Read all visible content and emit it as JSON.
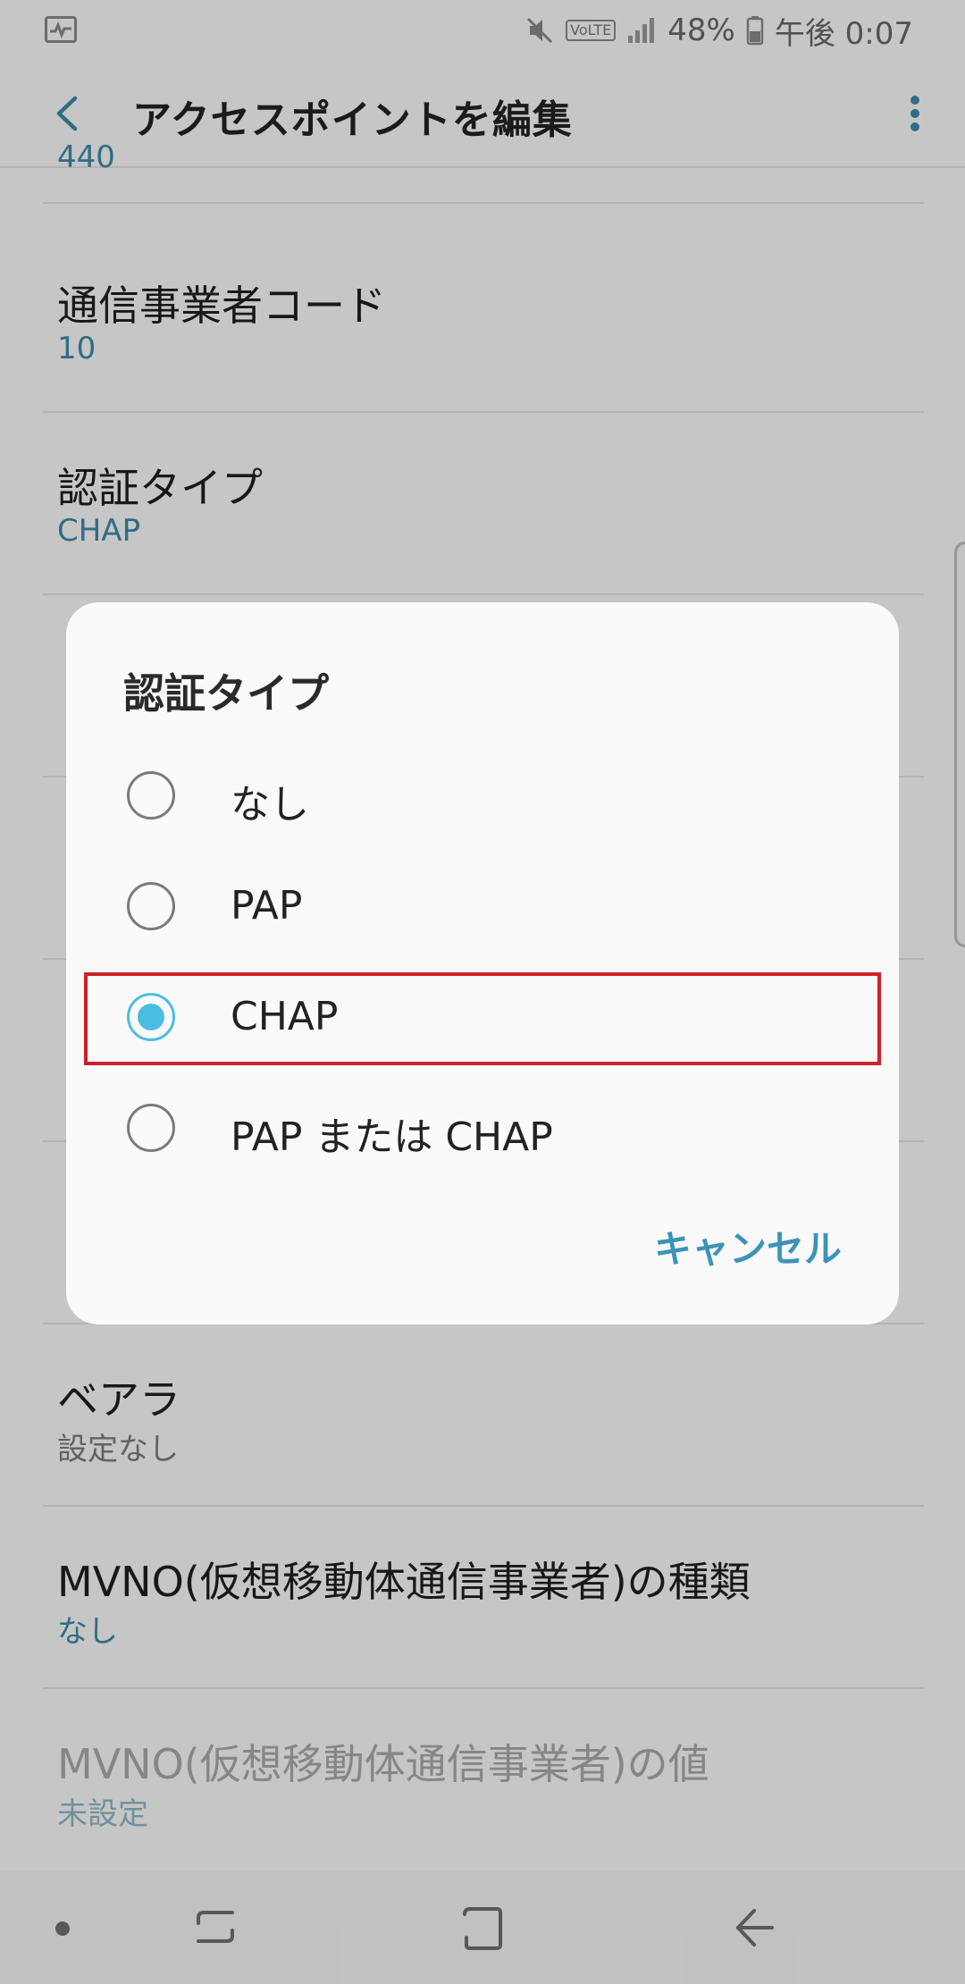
{
  "status_bar": {
    "battery_percent": "48%",
    "time": "午後 0:07",
    "volte_label": "VoLTE",
    "icons": [
      "activity-icon",
      "mute-icon",
      "volte-icon",
      "signal-icon",
      "battery-icon"
    ]
  },
  "app_bar": {
    "title": "アクセスポイントを編集",
    "back_icon": "chevron-left-icon",
    "more_icon": "more-vert-icon"
  },
  "list": {
    "partial_top_value": "440",
    "items": [
      {
        "title": "通信事業者コード",
        "value": "10"
      },
      {
        "title": "認証タイプ",
        "value": "CHAP"
      },
      {
        "title": "ベアラ",
        "value": "設定なし"
      },
      {
        "title": "MVNO(仮想移動体通信事業者)の種類",
        "value": "なし"
      },
      {
        "title": "MVNO(仮想移動体通信事業者)の値",
        "value": "未設定"
      }
    ]
  },
  "dialog": {
    "title": "認証タイプ",
    "options": [
      {
        "label": "なし",
        "selected": false
      },
      {
        "label": "PAP",
        "selected": false
      },
      {
        "label": "CHAP",
        "selected": true
      },
      {
        "label": "PAP または CHAP",
        "selected": false
      }
    ],
    "cancel_label": "キャンセル",
    "highlight_color": "#cc2229",
    "accent_color": "#4bbde1"
  },
  "nav_bar": {
    "icons": [
      "nav-dot-icon",
      "recent-apps-icon",
      "home-icon",
      "back-icon"
    ]
  }
}
